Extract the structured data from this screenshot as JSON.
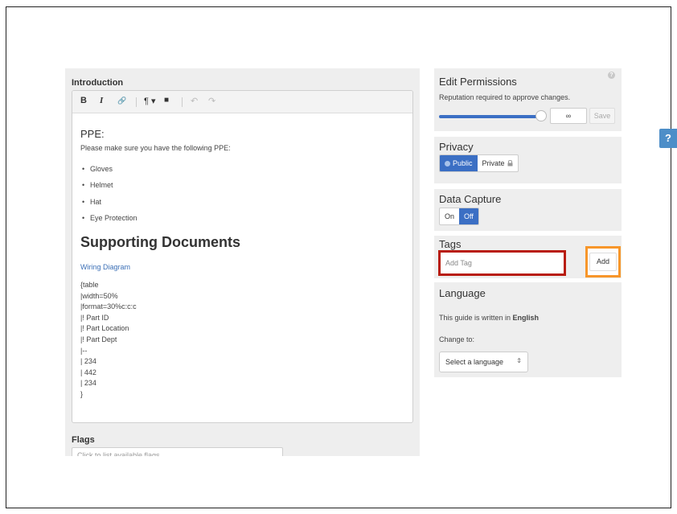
{
  "editor": {
    "intro_label": "Introduction",
    "toolbar": {
      "bold": "B",
      "italic": "I",
      "link": "🔗",
      "paragraph": "¶ ▾",
      "video": "■",
      "undo": "↶",
      "redo": "↷"
    },
    "ppe_heading": "PPE:",
    "ppe_description": "Please make sure you have the following PPE:",
    "ppe_items": [
      "Gloves",
      "Helmet",
      "Hat",
      "Eye Protection"
    ],
    "docs_heading": "Supporting Documents",
    "wiring_link": "Wiring Diagram",
    "markup_lines": [
      "{table",
      "|width=50%",
      "|format=30%c:c:c",
      "|! Part ID",
      "|! Part Location",
      "|! Part Dept",
      "|--",
      "| 234",
      "| 442",
      "| 234",
      "}"
    ]
  },
  "flags": {
    "label": "Flags",
    "placeholder": "Click to list available flags..."
  },
  "edit_permissions": {
    "title": "Edit Permissions",
    "help": "?",
    "subtitle": "Reputation required to approve changes.",
    "slider_level": 1.0,
    "value": "∞",
    "save_label": "Save",
    "accent_color": "#3b6fc4"
  },
  "privacy": {
    "title": "Privacy",
    "public_label": "Public",
    "private_label": "Private",
    "public_icon": "globe-icon",
    "private_icon": "lock-icon",
    "selected": "Public"
  },
  "data_capture": {
    "title": "Data Capture",
    "on_label": "On",
    "off_label": "Off",
    "selected": "Off"
  },
  "tags": {
    "title": "Tags",
    "placeholder": "Add Tag",
    "add_label": "Add",
    "input_highlight_color": "#b81d0f",
    "button_highlight_color": "#f7962a"
  },
  "language": {
    "title": "Language",
    "written_prefix": "This guide is written in ",
    "written_language": "English",
    "change_to": "Change to:",
    "select_value": "Select a language"
  },
  "floating_help": "?"
}
